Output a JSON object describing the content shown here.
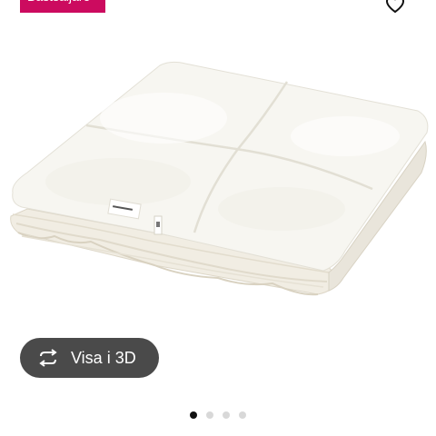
{
  "badge": {
    "label": "Bästsäljare",
    "color": "#cc0b5f"
  },
  "favorite": {
    "icon": "heart-outline-icon"
  },
  "product": {
    "image": "duvet-folded-white"
  },
  "viewer_button": {
    "icon": "rotate-3d-icon",
    "label": "Visa i 3D"
  },
  "carousel": {
    "dot_count": 4,
    "active_index": 0
  }
}
